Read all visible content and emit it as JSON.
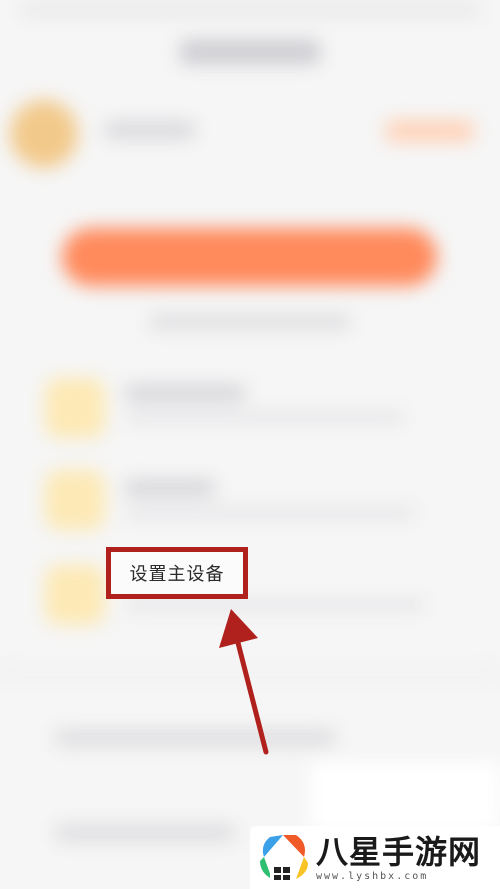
{
  "annotation": {
    "label": "设置主设备",
    "box_color": "#b0201c",
    "arrow_color": "#b0201c"
  },
  "watermark": {
    "brand": "八星手游网",
    "url": "www.lyshbx.com",
    "logo_icon": "colorful-pinwheel-house-icon"
  },
  "colors": {
    "accent_button": "#ff8a5c",
    "item_icon": "#fde9b5",
    "background": "#f6f6f6"
  }
}
